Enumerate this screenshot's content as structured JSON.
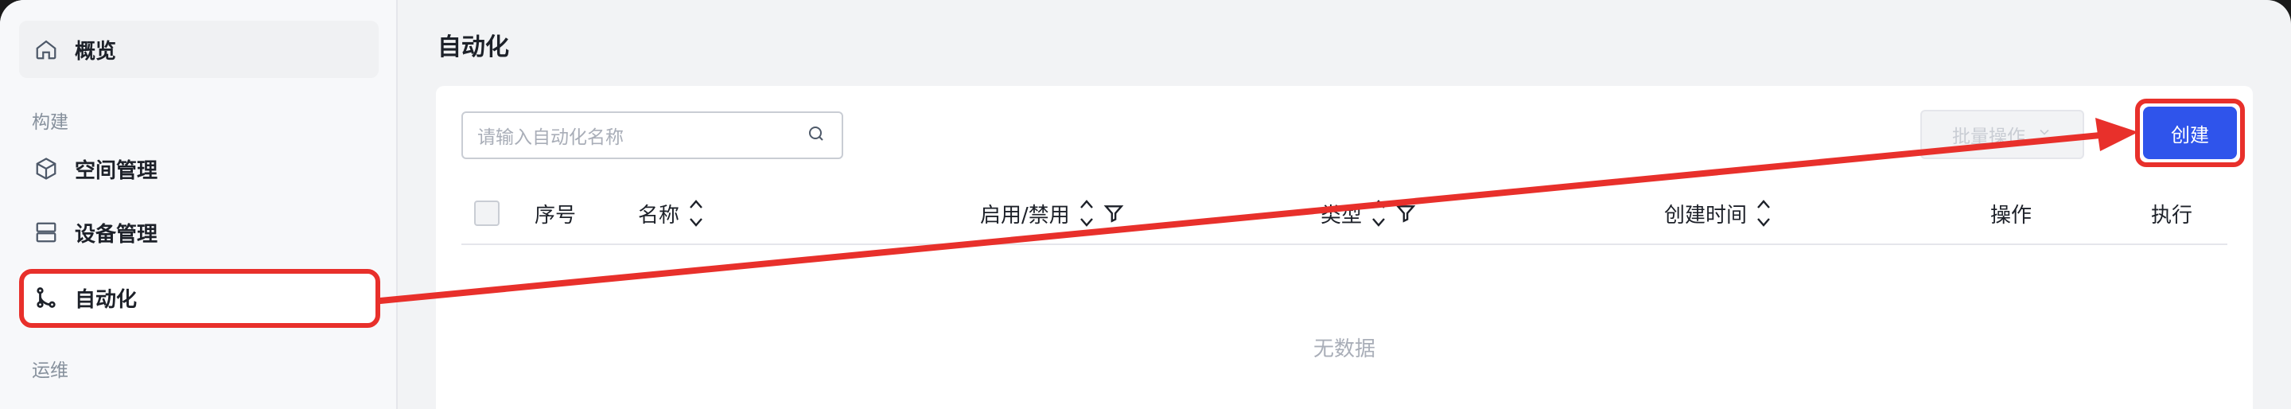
{
  "sidebar": {
    "items": [
      {
        "label": "概览",
        "icon": "home-icon"
      },
      {
        "label": "空间管理",
        "icon": "cube-icon"
      },
      {
        "label": "设备管理",
        "icon": "server-icon"
      },
      {
        "label": "自动化",
        "icon": "flow-icon"
      }
    ],
    "sections": [
      "构建",
      "运维"
    ]
  },
  "main": {
    "title": "自动化",
    "search_placeholder": "请输入自动化名称",
    "batch_label": "批量操作",
    "create_label": "创建",
    "columns": [
      "序号",
      "名称",
      "启用/禁用",
      "类型",
      "创建时间",
      "操作",
      "执行"
    ],
    "empty_text": "无数据"
  },
  "colors": {
    "accent": "#2f54eb",
    "annotation": "#e8302b"
  }
}
